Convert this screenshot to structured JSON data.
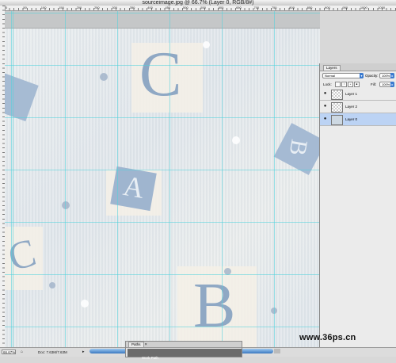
{
  "window": {
    "title": "sourceimage.jpg @ 66.7% (Layer 0, RGB/8#)"
  },
  "ruler": {
    "labels": [
      "0",
      "50",
      "100",
      "150",
      "200",
      "250",
      "300",
      "350",
      "400",
      "450",
      "500",
      "550",
      "600",
      "650",
      "700",
      "750",
      "800",
      "850",
      "900",
      "950",
      "1000",
      "1050"
    ]
  },
  "canvas": {
    "letters": [
      "C",
      "A",
      "B",
      "B",
      "C"
    ]
  },
  "status": {
    "zoom": "66.67%",
    "doc": "Doc: 7.63M/7.63M"
  },
  "paths_panel": {
    "tab": "Paths",
    "row_label": "Work Path"
  },
  "layers_panel": {
    "tab": "Layers",
    "blend_mode": "Normal",
    "opacity_label": "Opacity:",
    "opacity_value": "100%",
    "lock_label": "Lock:",
    "fill_label": "Fill:",
    "fill_value": "100%",
    "layers": [
      {
        "name": "Layer 1",
        "active": false
      },
      {
        "name": "Layer 2",
        "active": false
      },
      {
        "name": "Layer 0",
        "active": true
      }
    ]
  },
  "watermark": "www.36ps.cn",
  "colors": {
    "guide": "#50d2dc",
    "scroll": "#3a78c0",
    "active_layer": "#bcd3f4"
  }
}
